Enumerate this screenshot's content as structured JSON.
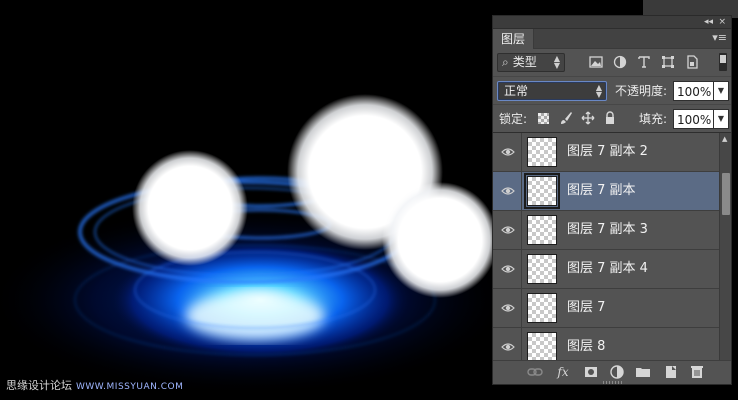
{
  "watermark": {
    "site": "思缘设计论坛",
    "url": "WWW.MISSYUAN.COM"
  },
  "panel": {
    "collapse_icon": "◂◂",
    "close_icon": "×",
    "tab": "图层",
    "menu_icon": "▾≡",
    "filter": {
      "kind": "类型",
      "search_icon": "⌕"
    },
    "filter_icons": [
      "image-filter-icon",
      "adjustment-filter-icon",
      "type-filter-icon",
      "shape-filter-icon",
      "smart-object-filter-icon"
    ],
    "blend_mode": "正常",
    "opacity_label": "不透明度:",
    "opacity_value": "100%",
    "lock_label": "锁定:",
    "fill_label": "填充:",
    "fill_value": "100%",
    "layers": [
      {
        "name": "图层 7 副本 2",
        "selected": false
      },
      {
        "name": "图层 7 副本",
        "selected": true
      },
      {
        "name": "图层 7 副本 3",
        "selected": false
      },
      {
        "name": "图层 7 副本 4",
        "selected": false
      },
      {
        "name": "图层 7",
        "selected": false
      },
      {
        "name": "图层 8",
        "selected": false
      }
    ],
    "bottom_icons": [
      "link-icon",
      "fx-icon",
      "mask-icon",
      "adjustment-icon",
      "folder-icon",
      "new-layer-icon",
      "trash-icon"
    ],
    "bottom_labels": {
      "fx": "fx"
    },
    "accent": "#5b6b85"
  }
}
